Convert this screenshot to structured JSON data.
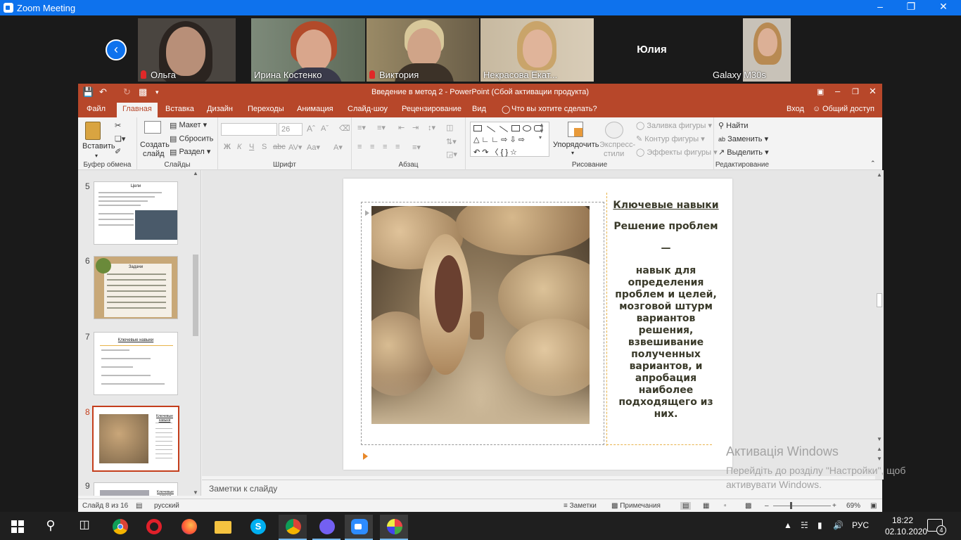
{
  "zoom": {
    "title": "Zoom Meeting",
    "participants": [
      {
        "name": "Ольга",
        "muted": true
      },
      {
        "name": "Ирина Костенко",
        "muted": false,
        "active": true
      },
      {
        "name": "Виктория",
        "muted": true
      },
      {
        "name": "Некрасова Екат...",
        "muted": false
      },
      {
        "name": "Юлия",
        "muted": false,
        "no_video": true
      },
      {
        "name": "Galaxy M30s",
        "muted": false
      }
    ]
  },
  "ppt": {
    "title": "Введение в метод 2 - PowerPoint (Сбой активации продукта)",
    "menu": [
      "Файл",
      "Главная",
      "Вставка",
      "Дизайн",
      "Переходы",
      "Анимация",
      "Слайд-шоу",
      "Рецензирование",
      "Вид"
    ],
    "tell_me": "Что вы хотите сделать?",
    "signin": "Вход",
    "share": "Общий доступ",
    "ribbon": {
      "paste": "Вставить",
      "clipboard": "Буфер обмена",
      "create_slide": "Создать",
      "create_slide2": "слайд",
      "layout": "Макет",
      "reset": "Сбросить",
      "section": "Раздел",
      "slides": "Слайды",
      "font_size": "26",
      "font": "Шрифт",
      "paragraph": "Абзац",
      "arrange": "Упорядочить",
      "quick_styles": "Экспресс-",
      "quick_styles2": "стили",
      "shape_fill": "Заливка фигуры",
      "shape_outline": "Контур фигуры",
      "shape_effects": "Эффекты фигуры",
      "drawing": "Рисование",
      "find": "Найти",
      "replace": "Заменить",
      "select": "Выделить",
      "editing": "Редактирование"
    },
    "thumbs": [
      {
        "num": "5",
        "title": "Цели"
      },
      {
        "num": "6",
        "title": "Задачи"
      },
      {
        "num": "7",
        "title": "Ключевые навыки"
      },
      {
        "num": "8",
        "title": "Ключевые навыки",
        "selected": true
      },
      {
        "num": "9",
        "title": "Ключевые навыки"
      }
    ],
    "slide": {
      "heading": "Ключевые навыки",
      "subheading": "Решение проблем",
      "dash": "—",
      "body": "навык для определения проблем и целей, мозговой штурм вариантов решения, взвешивание полученных вариантов, и апробация наиболее подходящего из них."
    },
    "notes_placeholder": "Заметки к слайду",
    "status": {
      "slide_of": "Слайд 8 из 16",
      "language": "русский",
      "notes": "Заметки",
      "comments": "Примечания",
      "zoom": "69%"
    }
  },
  "watermark": {
    "line1": "Активація Windows",
    "line2": "Перейдіть до розділу \"Настройки\", щоб",
    "line3": "активувати Windows."
  },
  "taskbar": {
    "lang": "РУС",
    "time": "18:22",
    "date": "02.10.2020",
    "notifications": "4"
  },
  "colors": {
    "zoom_blue": "#0e72ed",
    "ppt_red": "#b7472a",
    "slide_text": "#3a3a2a"
  }
}
